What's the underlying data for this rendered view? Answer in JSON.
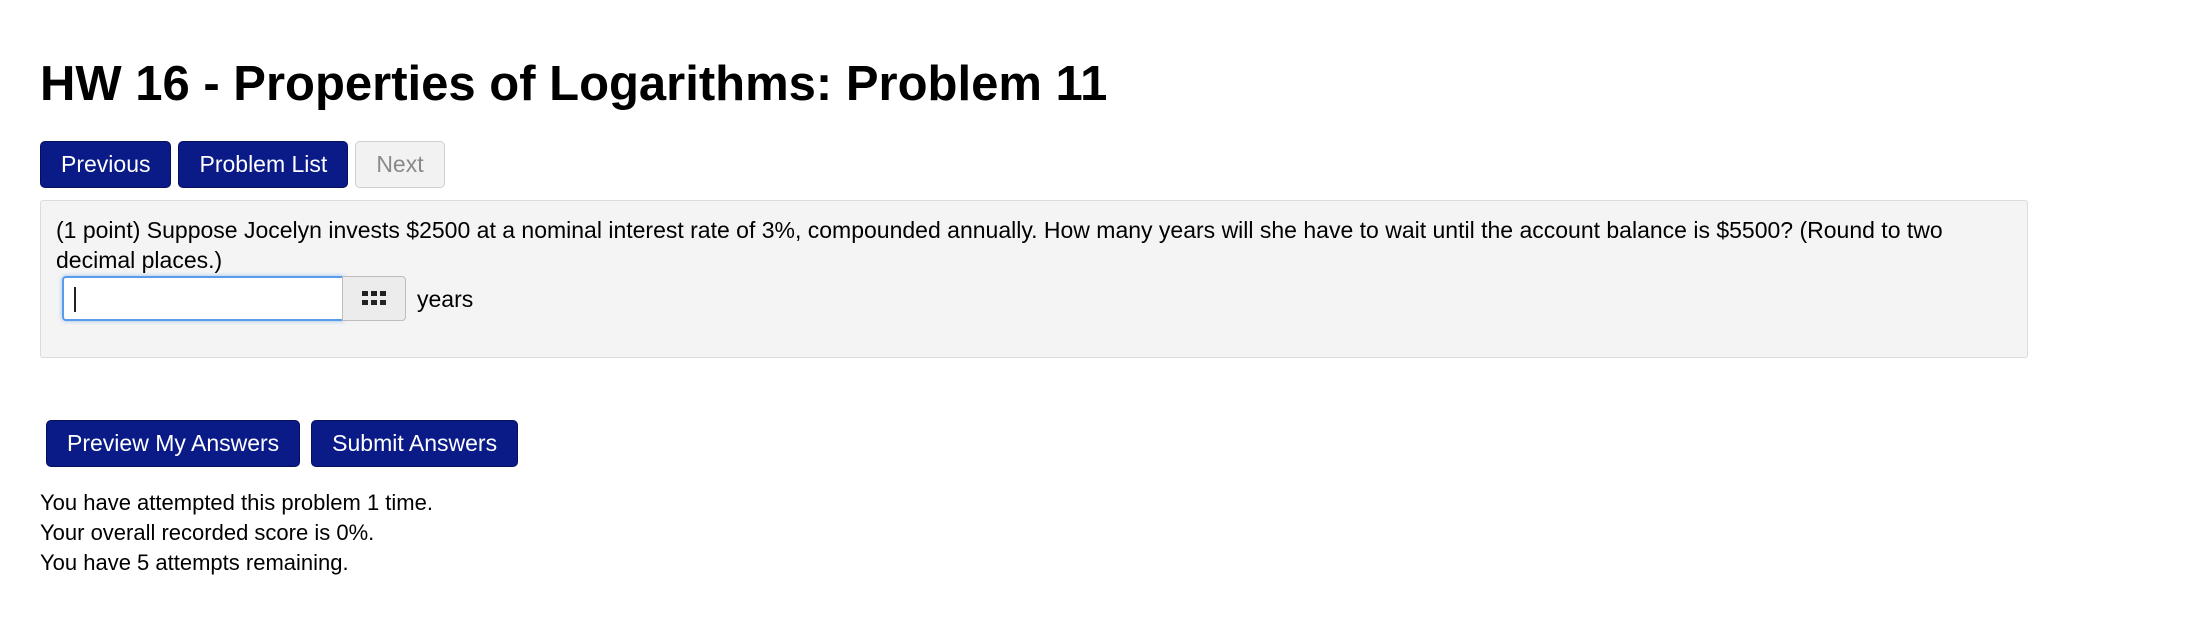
{
  "page": {
    "title": "HW 16 - Properties of Logarithms: Problem 11"
  },
  "nav": {
    "previous_label": "Previous",
    "problem_list_label": "Problem List",
    "next_label": "Next"
  },
  "problem": {
    "text": "(1 point) Suppose Jocelyn invests $2500 at a nominal interest rate of 3%, compounded annually. How many years will she have to wait until the account balance is $5500? (Round to two decimal places.)",
    "answer_value": "",
    "palette_icon": "grid-icon",
    "unit": "years"
  },
  "actions": {
    "preview_label": "Preview My Answers",
    "submit_label": "Submit Answers"
  },
  "status": {
    "attempts": "You have attempted this problem 1 time.",
    "score": "Your overall recorded score is 0%.",
    "remaining": "You have 5 attempts remaining."
  },
  "colors": {
    "primary_button": "#0a1a87",
    "disabled_button": "#f2f2f2",
    "problem_background": "#f4f4f4",
    "input_focus": "#5a9bea"
  }
}
